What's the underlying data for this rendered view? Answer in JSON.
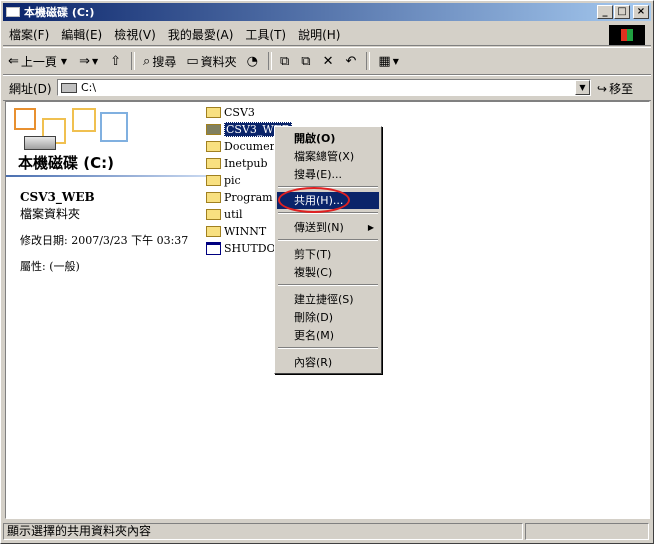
{
  "window": {
    "title": "本機磁碟 (C:)"
  },
  "menu": [
    "檔案(F)",
    "編輯(E)",
    "檢視(V)",
    "我的最愛(A)",
    "工具(T)",
    "說明(H)"
  ],
  "toolbar": {
    "back": "上一頁",
    "search": "搜尋",
    "folders": "資料夾"
  },
  "address": {
    "label": "網址(D)",
    "value": "C:\\",
    "go": "移至"
  },
  "left_pane": {
    "drive_title": "本機磁碟 (C:)",
    "selected_name": "CSV3_WEB",
    "selected_type": "檔案資料夾",
    "modified": "修改日期: 2007/3/23 下午 03:37",
    "attributes": "屬性: (一般)"
  },
  "files": [
    {
      "name": "CSV3",
      "icon": "folder-icon"
    },
    {
      "name": "CSV3_WEB",
      "icon": "shared-folder-icon",
      "selected": true
    },
    {
      "name": "Document",
      "icon": "folder-icon"
    },
    {
      "name": "Inetpub",
      "icon": "folder-icon"
    },
    {
      "name": "pic",
      "icon": "folder-icon"
    },
    {
      "name": "Program F",
      "icon": "folder-icon"
    },
    {
      "name": "util",
      "icon": "folder-icon"
    },
    {
      "name": "WINNT",
      "icon": "folder-icon"
    },
    {
      "name": "SHUTDOW",
      "icon": "document-icon"
    }
  ],
  "context_menu": {
    "open": "開啟(O)",
    "explore": "檔案總管(X)",
    "search": "搜尋(E)...",
    "sharing": "共用(H)...",
    "send_to": "傳送到(N)",
    "cut": "剪下(T)",
    "copy": "複製(C)",
    "create_shortcut": "建立捷徑(S)",
    "delete": "刪除(D)",
    "rename": "更名(M)",
    "properties": "內容(R)"
  },
  "status": {
    "text": "顯示選擇的共用資料夾內容"
  },
  "colors": {
    "title_bar": "#0a246a",
    "highlight": "#0a246a",
    "annotation_ring": "#e02020"
  }
}
